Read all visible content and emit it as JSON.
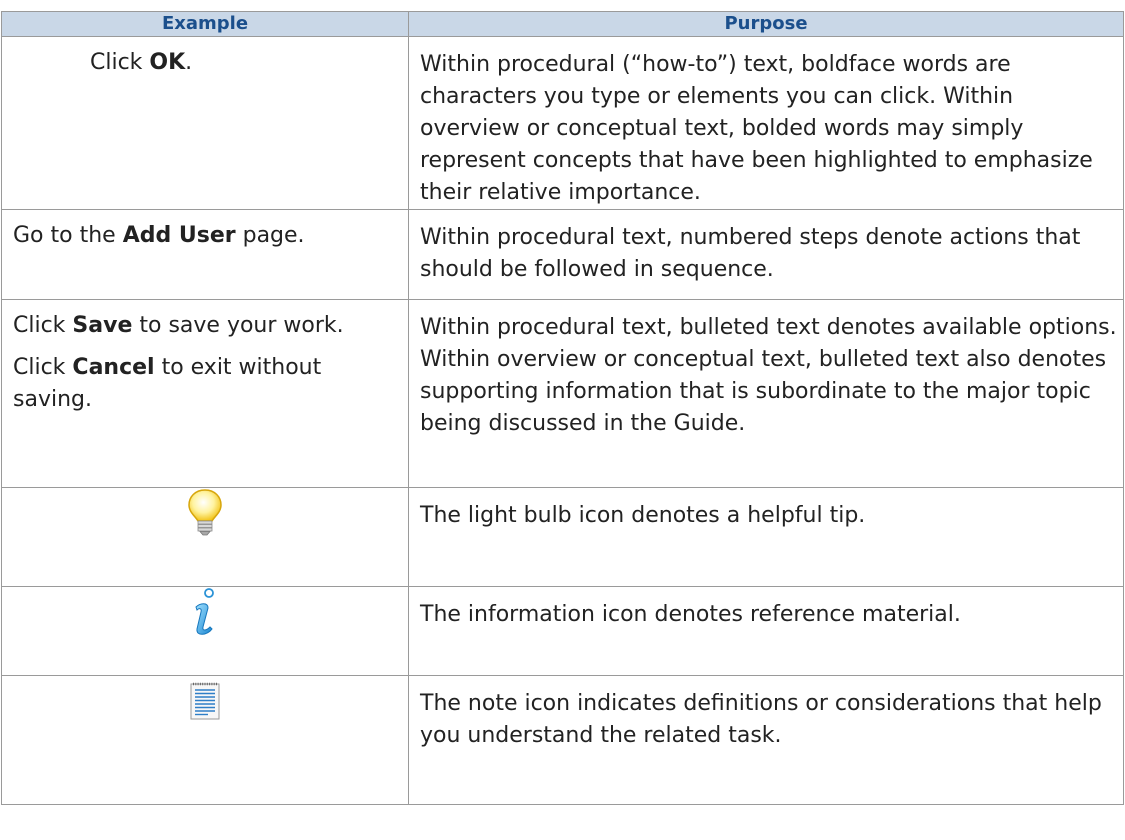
{
  "table": {
    "headers": [
      "Example",
      "Purpose"
    ],
    "rows": [
      {
        "example": {
          "pre": "Click ",
          "bold": "OK",
          "post": "."
        },
        "purpose": "Within procedural (“how-to”) text, boldface words are characters you type or elements you can click. Within overview or conceptual text, bolded words may simply represent concepts that have been highlighted to emphasize their relative importance."
      },
      {
        "example": {
          "pre": "Go to the ",
          "bold": "Add User",
          "post": " page."
        },
        "purpose": "Within procedural text, numbered steps denote actions that should be followed in sequence."
      },
      {
        "example_lines": [
          {
            "pre": "Click ",
            "bold": "Save",
            "post": " to save your work."
          },
          {
            "pre": "Click ",
            "bold": "Cancel",
            "post": " to exit without saving."
          }
        ],
        "purpose": "Within procedural text, bulleted text denotes available options. Within overview or conceptual text, bulleted text also denotes supporting information that is subordinate to the major topic being discussed in the Guide."
      },
      {
        "icon": "lightbulb-icon",
        "purpose": "The light bulb icon denotes a helpful tip."
      },
      {
        "icon": "info-icon",
        "purpose": "The information icon denotes reference material."
      },
      {
        "icon": "note-icon",
        "purpose": "The note icon indicates definitions or considerations that help you understand the related task."
      }
    ]
  },
  "colors": {
    "header_bg": "#c9d7e7",
    "header_text": "#1b4f8c",
    "border": "#9a9a9a"
  }
}
